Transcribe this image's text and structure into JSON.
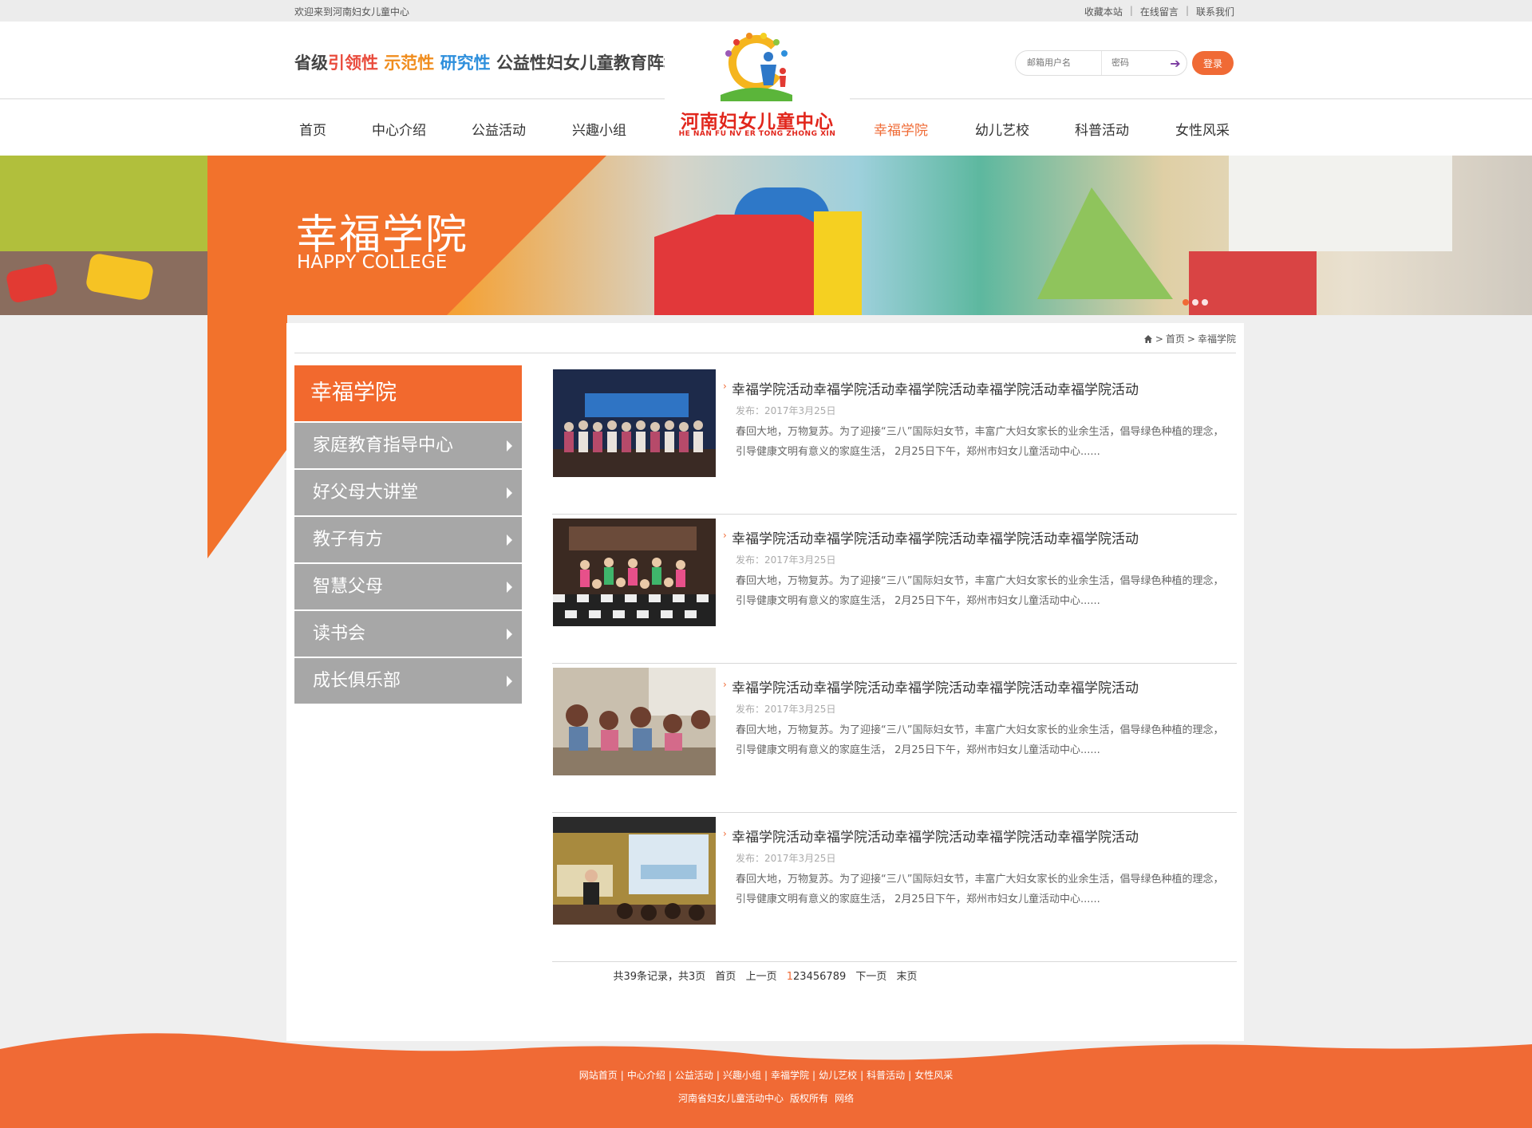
{
  "topbar": {
    "welcome": "欢迎来到河南妇女儿童中心",
    "links": [
      "收藏本站",
      "在线留言",
      "联系我们"
    ]
  },
  "slogan": {
    "p1": "省级",
    "p2": "引领性",
    "p3": "示范性",
    "p4": "研究性",
    "p5": "公益性妇女儿童教育阵地"
  },
  "logo": {
    "cn": "河南妇女儿童中心",
    "en": "HE NAN FU NV ER TONG  ZHONG XIN"
  },
  "login": {
    "user_placeholder": "邮箱用户名",
    "pass_placeholder": "密码",
    "button": "登录"
  },
  "nav": {
    "items": [
      "首页",
      "中心介绍",
      "公益活动",
      "兴趣小组",
      "幸福学院",
      "幼儿艺校",
      "科普活动",
      "女性风采"
    ],
    "active": "幸福学院"
  },
  "banner": {
    "title_cn": "幸福学院",
    "title_en": "HAPPY COLLEGE"
  },
  "breadcrumb": {
    "home": "首页",
    "current": "幸福学院"
  },
  "sidebar": {
    "title": "幸福学院",
    "items": [
      {
        "label": "家庭教育指导中心"
      },
      {
        "label": "好父母大讲堂"
      },
      {
        "label": "教子有方"
      },
      {
        "label": "智慧父母"
      },
      {
        "label": "读书会"
      },
      {
        "label": "成长俱乐部"
      }
    ]
  },
  "articles": [
    {
      "title": "幸福学院活动幸福学院活动幸福学院活动幸福学院活动幸福学院活动",
      "date": "发布：2017年3月25日",
      "desc": "春回大地，万物复苏。为了迎接“三八”国际妇女节，丰富广大妇女家长的业余生活，倡导绿色种植的理念，引导健康文明有意义的家庭生活， 2月25日下午，郑州市妇女儿童活动中心......"
    },
    {
      "title": "幸福学院活动幸福学院活动幸福学院活动幸福学院活动幸福学院活动",
      "date": "发布：2017年3月25日",
      "desc": "春回大地，万物复苏。为了迎接“三八”国际妇女节，丰富广大妇女家长的业余生活，倡导绿色种植的理念，引导健康文明有意义的家庭生活， 2月25日下午，郑州市妇女儿童活动中心......"
    },
    {
      "title": "幸福学院活动幸福学院活动幸福学院活动幸福学院活动幸福学院活动",
      "date": "发布：2017年3月25日",
      "desc": "春回大地，万物复苏。为了迎接“三八”国际妇女节，丰富广大妇女家长的业余生活，倡导绿色种植的理念，引导健康文明有意义的家庭生活， 2月25日下午，郑州市妇女儿童活动中心......"
    },
    {
      "title": "幸福学院活动幸福学院活动幸福学院活动幸福学院活动幸福学院活动",
      "date": "发布：2017年3月25日",
      "desc": "春回大地，万物复苏。为了迎接“三八”国际妇女节，丰富广大妇女家长的业余生活，倡导绿色种植的理念，引导健康文明有意义的家庭生活， 2月25日下午，郑州市妇女儿童活动中心......"
    }
  ],
  "pager": {
    "summary": "共39条记录，共3页",
    "first": "首页",
    "prev": "上一页",
    "pages": [
      "1",
      "2",
      "3",
      "4",
      "5",
      "6",
      "7",
      "8",
      "9"
    ],
    "current": "1",
    "next": "下一页",
    "last": "末页"
  },
  "footer": {
    "links": [
      "网站首页",
      "中心介绍",
      "公益活动",
      "兴趣小组",
      "幸福学院",
      "幼儿艺校",
      "科普活动",
      "女性风采"
    ],
    "copyright": "河南省妇女儿童活动中心",
    "rights": "版权所有",
    "network": "网络"
  },
  "colors": {
    "accent": "#f06a35",
    "sidebar_item": "#a7a7a7",
    "logo_red": "#e1261c"
  }
}
